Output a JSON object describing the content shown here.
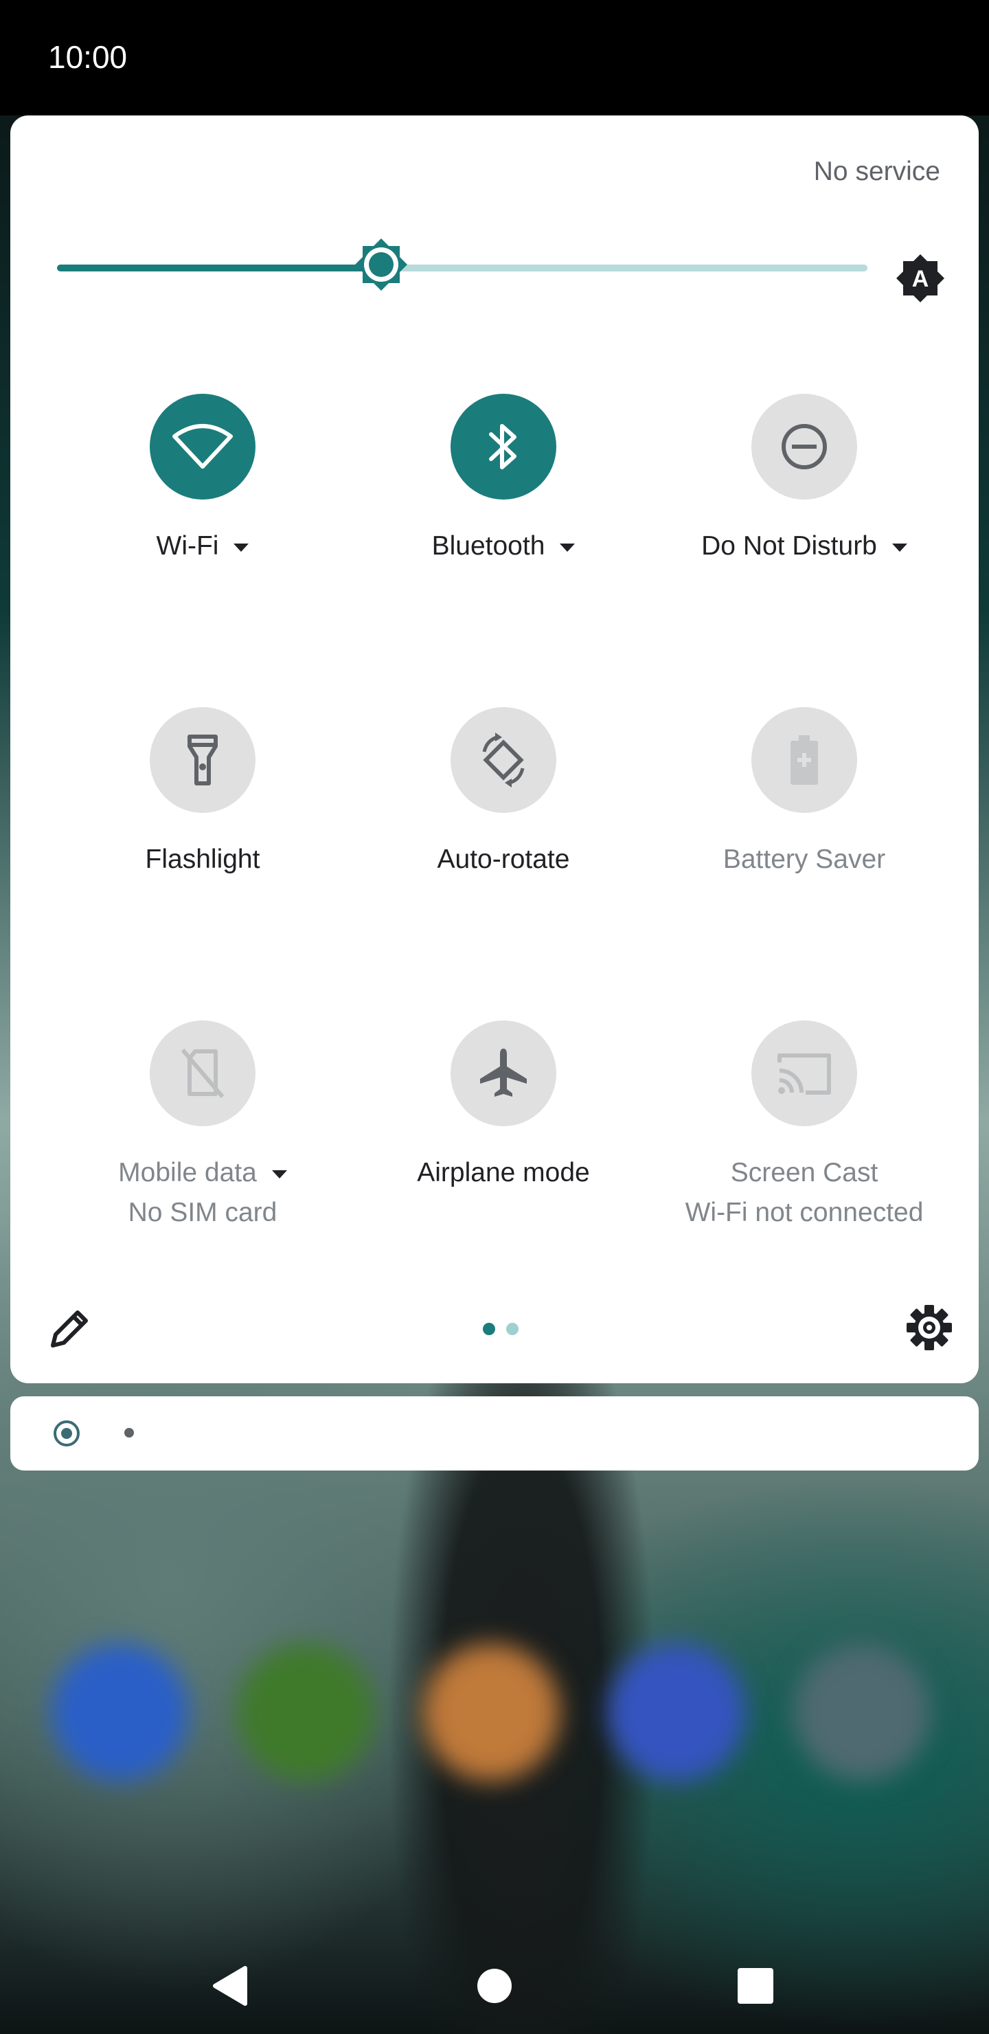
{
  "status_bar": {
    "time": "10:00"
  },
  "quick_settings": {
    "network_status": "No service",
    "brightness": {
      "level_fraction": 0.4
    },
    "tiles": [
      {
        "label": "Wi-Fi",
        "state": "on",
        "has_dropdown": true,
        "icon": "wifi-icon"
      },
      {
        "label": "Bluetooth",
        "state": "on",
        "has_dropdown": true,
        "icon": "bluetooth-icon"
      },
      {
        "label": "Do Not Disturb",
        "state": "off",
        "has_dropdown": true,
        "icon": "do-not-disturb-icon"
      },
      {
        "label": "Flashlight",
        "state": "off",
        "icon": "flashlight-icon"
      },
      {
        "label": "Auto-rotate",
        "state": "off",
        "icon": "auto-rotate-icon"
      },
      {
        "label": "Battery Saver",
        "state": "unavailable",
        "icon": "battery-saver-icon"
      },
      {
        "label": "Mobile data",
        "sublabel": "No SIM card",
        "state": "unavailable",
        "has_dropdown": true,
        "icon": "mobile-data-off-icon"
      },
      {
        "label": "Airplane mode",
        "state": "off",
        "icon": "airplane-icon"
      },
      {
        "label": "Screen Cast",
        "sublabel": "Wi-Fi not connected",
        "state": "unavailable",
        "icon": "cast-icon"
      }
    ],
    "pages": {
      "count": 2,
      "current": 1
    }
  },
  "colors": {
    "accent": "#1b7c7c",
    "tile_off": "#e0e0e0",
    "icon_off": "#5f6368",
    "text_primary": "#202124",
    "text_disabled": "#80868b"
  }
}
